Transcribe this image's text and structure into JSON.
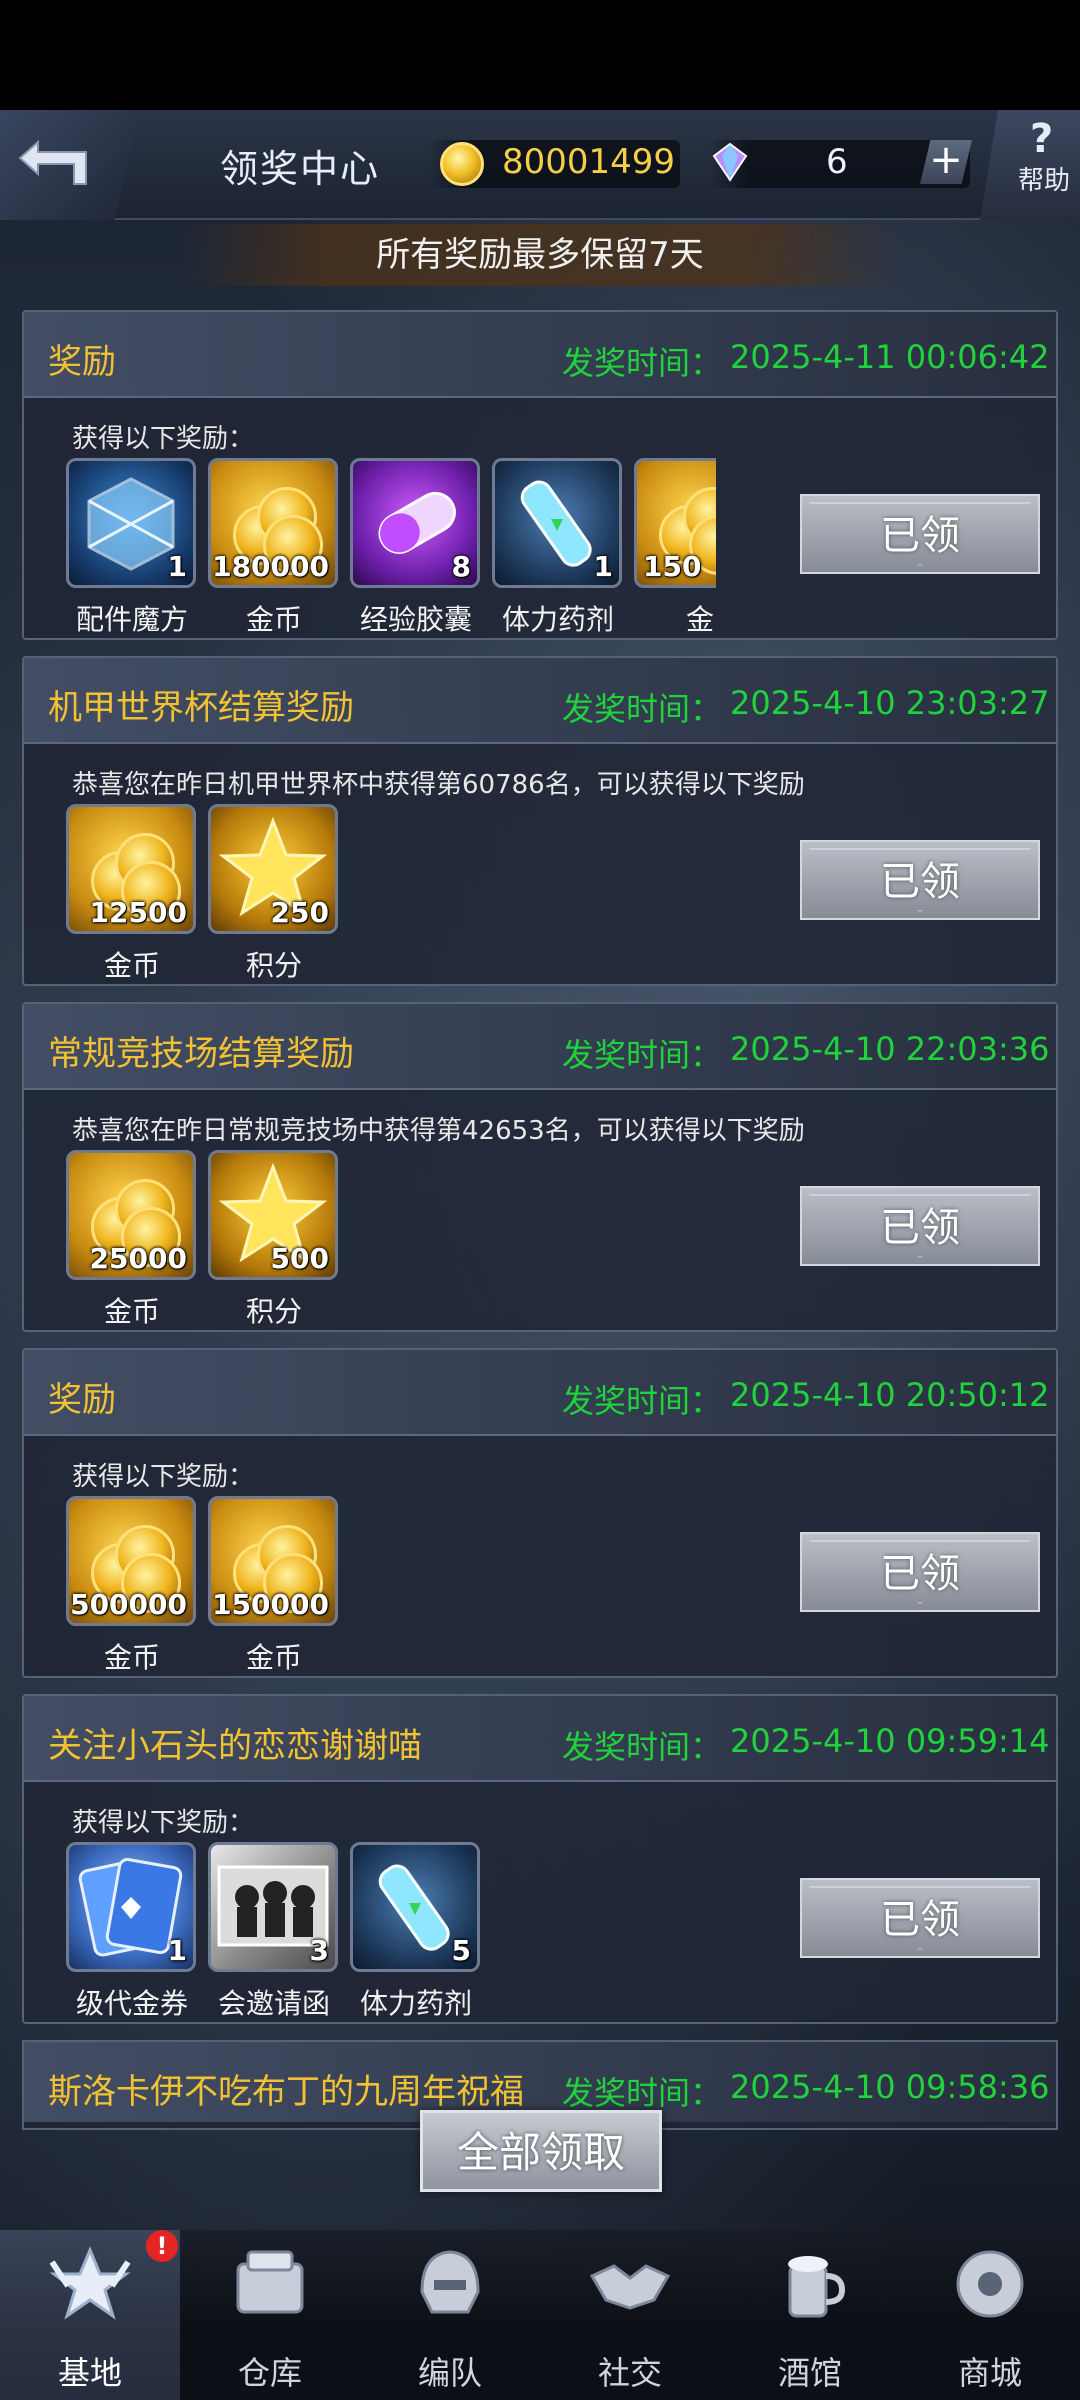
{
  "header": {
    "title": "领奖中心",
    "coins": "80001499",
    "gems": "6",
    "plus_label": "+",
    "help_label": "帮助",
    "help_symbol": "?"
  },
  "notice": "所有奖励最多保留7天",
  "time_label": "发奖时间：",
  "cards": [
    {
      "title": "奖励",
      "time": "2025-4-11 00:06:42",
      "desc": "获得以下奖励：",
      "claim_label": "已领",
      "items": [
        {
          "name": "配件魔方",
          "count": "1",
          "icon": "accessory-cube-icon"
        },
        {
          "name": "金币",
          "count": "180000",
          "icon": "gold-coins-icon"
        },
        {
          "name": "经验胶囊",
          "count": "8",
          "icon": "exp-capsule-icon"
        },
        {
          "name": "体力药剂",
          "count": "1",
          "icon": "stamina-potion-icon"
        },
        {
          "name": "金",
          "count": "150",
          "icon": "gold-coins-icon"
        }
      ]
    },
    {
      "title": "机甲世界杯结算奖励",
      "time": "2025-4-10 23:03:27",
      "desc": "恭喜您在昨日机甲世界杯中获得第60786名，可以获得以下奖励",
      "claim_label": "已领",
      "items": [
        {
          "name": "金币",
          "count": "12500",
          "icon": "gold-coins-icon"
        },
        {
          "name": "积分",
          "count": "250",
          "icon": "star-points-icon"
        }
      ]
    },
    {
      "title": "常规竞技场结算奖励",
      "time": "2025-4-10 22:03:36",
      "desc": "恭喜您在昨日常规竞技场中获得第42653名，可以获得以下奖励",
      "claim_label": "已领",
      "items": [
        {
          "name": "金币",
          "count": "25000",
          "icon": "gold-coins-icon"
        },
        {
          "name": "积分",
          "count": "500",
          "icon": "star-points-icon"
        }
      ]
    },
    {
      "title": "奖励",
      "time": "2025-4-10 20:50:12",
      "desc": "获得以下奖励：",
      "claim_label": "已领",
      "items": [
        {
          "name": "金币",
          "count": "500000",
          "icon": "gold-coins-icon"
        },
        {
          "name": "金币",
          "count": "150000",
          "icon": "gold-coins-icon"
        }
      ]
    },
    {
      "title": "关注小石头的恋恋谢谢喵",
      "time": "2025-4-10 09:59:14",
      "desc": "获得以下奖励：",
      "claim_label": "已领",
      "items": [
        {
          "name": "级代金券",
          "count": "1",
          "icon": "voucher-card-icon"
        },
        {
          "name": "会邀请函",
          "count": "3",
          "icon": "invitation-letter-icon"
        },
        {
          "name": "体力药剂",
          "count": "5",
          "icon": "stamina-potion-icon"
        }
      ]
    }
  ],
  "partial_card": {
    "title": "斯洛卡伊不吃布丁的九周年祝福",
    "time": "2025-4-10 09:58:36"
  },
  "claim_all_label": "全部领取",
  "nav": [
    {
      "label": "基地",
      "icon": "base-emblem-icon",
      "active": true,
      "badge": "!"
    },
    {
      "label": "仓库",
      "icon": "warehouse-icon"
    },
    {
      "label": "编队",
      "icon": "formation-helmet-icon"
    },
    {
      "label": "社交",
      "icon": "handshake-icon"
    },
    {
      "label": "酒馆",
      "icon": "tavern-icon"
    },
    {
      "label": "商城",
      "icon": "shop-robot-icon"
    }
  ],
  "colors": {
    "title_gold": "#f2c233",
    "time_green": "#20d23b",
    "coin_gold": "#f5cf45"
  }
}
